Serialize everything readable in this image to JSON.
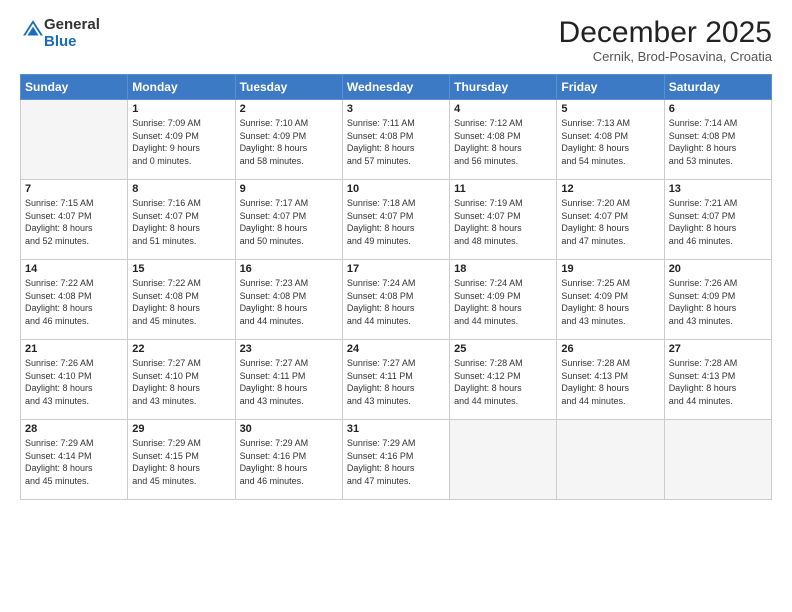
{
  "logo": {
    "general": "General",
    "blue": "Blue"
  },
  "title": "December 2025",
  "subtitle": "Cernik, Brod-Posavina, Croatia",
  "days_header": [
    "Sunday",
    "Monday",
    "Tuesday",
    "Wednesday",
    "Thursday",
    "Friday",
    "Saturday"
  ],
  "weeks": [
    [
      {
        "day": "",
        "empty": true
      },
      {
        "day": "1",
        "sunrise": "7:09 AM",
        "sunset": "4:09 PM",
        "daylight": "9 hours and 0 minutes."
      },
      {
        "day": "2",
        "sunrise": "7:10 AM",
        "sunset": "4:09 PM",
        "daylight": "8 hours and 58 minutes."
      },
      {
        "day": "3",
        "sunrise": "7:11 AM",
        "sunset": "4:08 PM",
        "daylight": "8 hours and 57 minutes."
      },
      {
        "day": "4",
        "sunrise": "7:12 AM",
        "sunset": "4:08 PM",
        "daylight": "8 hours and 56 minutes."
      },
      {
        "day": "5",
        "sunrise": "7:13 AM",
        "sunset": "4:08 PM",
        "daylight": "8 hours and 54 minutes."
      },
      {
        "day": "6",
        "sunrise": "7:14 AM",
        "sunset": "4:08 PM",
        "daylight": "8 hours and 53 minutes."
      }
    ],
    [
      {
        "day": "7",
        "sunrise": "7:15 AM",
        "sunset": "4:07 PM",
        "daylight": "8 hours and 52 minutes."
      },
      {
        "day": "8",
        "sunrise": "7:16 AM",
        "sunset": "4:07 PM",
        "daylight": "8 hours and 51 minutes."
      },
      {
        "day": "9",
        "sunrise": "7:17 AM",
        "sunset": "4:07 PM",
        "daylight": "8 hours and 50 minutes."
      },
      {
        "day": "10",
        "sunrise": "7:18 AM",
        "sunset": "4:07 PM",
        "daylight": "8 hours and 49 minutes."
      },
      {
        "day": "11",
        "sunrise": "7:19 AM",
        "sunset": "4:07 PM",
        "daylight": "8 hours and 48 minutes."
      },
      {
        "day": "12",
        "sunrise": "7:20 AM",
        "sunset": "4:07 PM",
        "daylight": "8 hours and 47 minutes."
      },
      {
        "day": "13",
        "sunrise": "7:21 AM",
        "sunset": "4:07 PM",
        "daylight": "8 hours and 46 minutes."
      }
    ],
    [
      {
        "day": "14",
        "sunrise": "7:22 AM",
        "sunset": "4:08 PM",
        "daylight": "8 hours and 46 minutes."
      },
      {
        "day": "15",
        "sunrise": "7:22 AM",
        "sunset": "4:08 PM",
        "daylight": "8 hours and 45 minutes."
      },
      {
        "day": "16",
        "sunrise": "7:23 AM",
        "sunset": "4:08 PM",
        "daylight": "8 hours and 44 minutes."
      },
      {
        "day": "17",
        "sunrise": "7:24 AM",
        "sunset": "4:08 PM",
        "daylight": "8 hours and 44 minutes."
      },
      {
        "day": "18",
        "sunrise": "7:24 AM",
        "sunset": "4:09 PM",
        "daylight": "8 hours and 44 minutes."
      },
      {
        "day": "19",
        "sunrise": "7:25 AM",
        "sunset": "4:09 PM",
        "daylight": "8 hours and 43 minutes."
      },
      {
        "day": "20",
        "sunrise": "7:26 AM",
        "sunset": "4:09 PM",
        "daylight": "8 hours and 43 minutes."
      }
    ],
    [
      {
        "day": "21",
        "sunrise": "7:26 AM",
        "sunset": "4:10 PM",
        "daylight": "8 hours and 43 minutes."
      },
      {
        "day": "22",
        "sunrise": "7:27 AM",
        "sunset": "4:10 PM",
        "daylight": "8 hours and 43 minutes."
      },
      {
        "day": "23",
        "sunrise": "7:27 AM",
        "sunset": "4:11 PM",
        "daylight": "8 hours and 43 minutes."
      },
      {
        "day": "24",
        "sunrise": "7:27 AM",
        "sunset": "4:11 PM",
        "daylight": "8 hours and 43 minutes."
      },
      {
        "day": "25",
        "sunrise": "7:28 AM",
        "sunset": "4:12 PM",
        "daylight": "8 hours and 44 minutes."
      },
      {
        "day": "26",
        "sunrise": "7:28 AM",
        "sunset": "4:13 PM",
        "daylight": "8 hours and 44 minutes."
      },
      {
        "day": "27",
        "sunrise": "7:28 AM",
        "sunset": "4:13 PM",
        "daylight": "8 hours and 44 minutes."
      }
    ],
    [
      {
        "day": "28",
        "sunrise": "7:29 AM",
        "sunset": "4:14 PM",
        "daylight": "8 hours and 45 minutes."
      },
      {
        "day": "29",
        "sunrise": "7:29 AM",
        "sunset": "4:15 PM",
        "daylight": "8 hours and 45 minutes."
      },
      {
        "day": "30",
        "sunrise": "7:29 AM",
        "sunset": "4:16 PM",
        "daylight": "8 hours and 46 minutes."
      },
      {
        "day": "31",
        "sunrise": "7:29 AM",
        "sunset": "4:16 PM",
        "daylight": "8 hours and 47 minutes."
      },
      {
        "day": "",
        "empty": true
      },
      {
        "day": "",
        "empty": true
      },
      {
        "day": "",
        "empty": true
      }
    ]
  ]
}
